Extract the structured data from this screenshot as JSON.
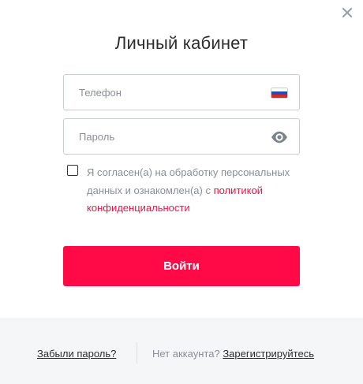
{
  "modal": {
    "title": "Личный кабинет",
    "close_icon": "close-icon"
  },
  "phone": {
    "placeholder": "Телефон",
    "value": "",
    "flag_icon": "russia-flag-icon"
  },
  "password": {
    "placeholder": "Пароль",
    "value": "",
    "toggle_icon": "eye-icon"
  },
  "consent": {
    "checked": false,
    "text": "Я согласен(а) на обработку персональных данных и ознакомлен(а) с",
    "link_text": "политикой конфиденциальности"
  },
  "login_button": {
    "label": "Войти"
  },
  "footer": {
    "forgot_link": "Забыли пароль?",
    "no_account_text": "Нет аккаунта?",
    "register_link": "Зарегистрируйтесь"
  },
  "colors": {
    "accent": "#ff0a47",
    "link": "#e8154a",
    "text": "#2d2d2d",
    "muted": "#8a8f96",
    "footer_bg": "#f5f6f8"
  }
}
